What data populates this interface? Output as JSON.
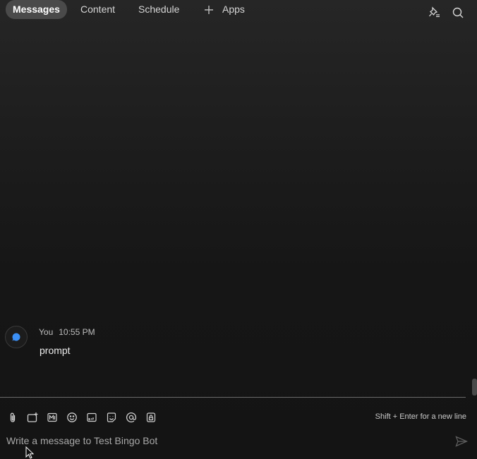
{
  "tabs": [
    {
      "label": "Messages",
      "active": true
    },
    {
      "label": "Content",
      "active": false
    },
    {
      "label": "Schedule",
      "active": false
    },
    {
      "label": "Apps",
      "active": false
    }
  ],
  "header_icons": [
    "pinned-messages-icon",
    "search-icon"
  ],
  "message": {
    "sender": "You",
    "time": "10:55 PM",
    "text": "prompt",
    "avatar_icon": "chat-bubble-icon"
  },
  "composer": {
    "toolbar_icons": [
      "attach-icon",
      "screenshot-icon",
      "format-icon",
      "emoji-icon",
      "gif-icon",
      "sticker-icon",
      "mention-icon",
      "lock-icon"
    ],
    "hint": "Shift + Enter for a new line",
    "value": "",
    "placeholder": "Write a message to Test Bingo Bot",
    "send_icon": "send-icon"
  },
  "colors": {
    "background": "#141414",
    "active_tab": "#4a4a4a",
    "avatar_accent": "#3b8ff5"
  }
}
